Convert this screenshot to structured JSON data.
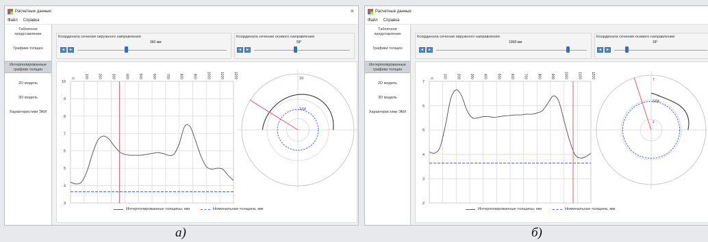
{
  "panels": [
    {
      "id": "a",
      "window_title": "Расчетные данные",
      "close_symbol": "×",
      "menu": [
        "Файл",
        "Справка"
      ],
      "sidebar": [
        {
          "label": "Табличное\nпредставление",
          "selected": false
        },
        {
          "label": "Графики толщин",
          "selected": false
        },
        {
          "label": "Интерполированные\nграфики толщин",
          "selected": true
        },
        {
          "label": "2D модель",
          "selected": false
        },
        {
          "label": "3D модель",
          "selected": false
        },
        {
          "label": "Характеристики ЭКИ",
          "selected": false
        }
      ],
      "circ_label": "Координата сечения окружного направления",
      "circ_value": "360 мм",
      "circ_position": 0.3,
      "axial_label": "Координата сечения осевого направления",
      "axial_value": "58°",
      "axial_position": 0.43,
      "legend_interp": "Интерполированные толщины, мм",
      "legend_nominal": "Номинальная толщина, мм",
      "caption": "а)"
    },
    {
      "id": "b",
      "window_title": "Расчетные данные",
      "close_symbol": "",
      "menu": [
        "Файл",
        "Справка"
      ],
      "sidebar": [
        {
          "label": "Табличное\nпредставление",
          "selected": false
        },
        {
          "label": "Графики толщин",
          "selected": false
        },
        {
          "label": "Интерполированные\nграфики толщин",
          "selected": true
        },
        {
          "label": "2D модель",
          "selected": false
        },
        {
          "label": "3D модель",
          "selected": false
        },
        {
          "label": "Характеристики ЭКИ",
          "selected": false
        }
      ],
      "circ_label": "Координата сечения окружного направления",
      "circ_value": "1068 мм",
      "circ_position": 0.87,
      "axial_label": "Координата сечения осевого направления",
      "axial_value": "18°",
      "axial_position": 0.12,
      "legend_interp": "Интерполированные толщины, мм",
      "legend_nominal": "Номинальная толщина, мм",
      "caption": "б)"
    }
  ],
  "colors": {
    "accent": "#2f6fbf",
    "cursor_line": "#e05a66",
    "nominal_line": "#4a63d8",
    "curve": "#5c5c5c",
    "arc": "#333333"
  },
  "chart_data": [
    {
      "type": "line",
      "panel": "a",
      "x": [
        0,
        40,
        80,
        120,
        160,
        200,
        240,
        280,
        320,
        360,
        400,
        440,
        480,
        520,
        560,
        600,
        640,
        680,
        720,
        760,
        800,
        840,
        880,
        920,
        960,
        1000,
        1040,
        1080,
        1120,
        1160,
        1200
      ],
      "x_ticks": [
        0,
        100,
        200,
        300,
        400,
        500,
        600,
        700,
        800,
        900,
        1000,
        1100,
        1200
      ],
      "y_ticks": [
        3,
        4,
        5,
        6,
        7,
        8,
        9,
        10
      ],
      "ylim": [
        3,
        10
      ],
      "xlim": [
        0,
        1200
      ],
      "series": [
        {
          "name": "Интерполированные толщины, мм",
          "values": [
            4.2,
            4.1,
            4.2,
            4.8,
            5.8,
            6.6,
            6.85,
            6.7,
            6.3,
            5.95,
            5.8,
            5.75,
            5.75,
            5.75,
            5.8,
            5.85,
            5.9,
            5.85,
            5.75,
            5.8,
            6.4,
            7.4,
            7.4,
            6.6,
            5.7,
            5.1,
            4.95,
            5.0,
            4.95,
            4.6,
            4.3
          ]
        },
        {
          "name": "Номинальная толщина, мм",
          "values": [
            3.65,
            3.65
          ]
        }
      ],
      "cursor_x": 360,
      "polar": {
        "outer_label": "10",
        "inner_label": "3.64",
        "cursor_angle_deg": 58,
        "arc_start_deg": 0,
        "arc_end_deg": 180,
        "arc_r": 6.3,
        "nominal_r": 3.64,
        "rmax": 10
      }
    },
    {
      "type": "line",
      "panel": "b",
      "x": [
        0,
        40,
        80,
        120,
        160,
        200,
        240,
        280,
        320,
        360,
        400,
        440,
        480,
        520,
        560,
        600,
        640,
        680,
        720,
        760,
        800,
        840,
        880,
        920,
        960,
        1000,
        1040,
        1080,
        1120,
        1160,
        1200
      ],
      "x_ticks": [
        0,
        100,
        200,
        300,
        400,
        500,
        600,
        700,
        800,
        900,
        1000,
        1100,
        1200
      ],
      "y_ticks": [
        2,
        3,
        4,
        5,
        6,
        7
      ],
      "ylim": [
        2,
        7
      ],
      "xlim": [
        0,
        1200
      ],
      "series": [
        {
          "name": "Интерполированные толщины, мм",
          "values": [
            4.1,
            4.05,
            4.3,
            5.2,
            6.3,
            6.65,
            6.4,
            5.8,
            5.5,
            5.5,
            5.55,
            5.55,
            5.52,
            5.55,
            5.58,
            5.6,
            5.62,
            5.62,
            5.65,
            5.65,
            5.7,
            5.8,
            6.1,
            6.4,
            6.2,
            5.4,
            4.6,
            4.0,
            3.85,
            3.9,
            4.05
          ]
        },
        {
          "name": "Номинальная толщина, мм",
          "values": [
            3.64,
            3.64
          ]
        }
      ],
      "cursor_x": 1068,
      "polar": {
        "outer_label": "7",
        "inner_label": "3.64",
        "center_label": "2",
        "cursor_angle_deg": 18,
        "arc_start_deg": 0,
        "arc_end_deg": 90,
        "arc_r": 4.7,
        "nominal_r": 3.64,
        "rmax": 7
      }
    }
  ]
}
